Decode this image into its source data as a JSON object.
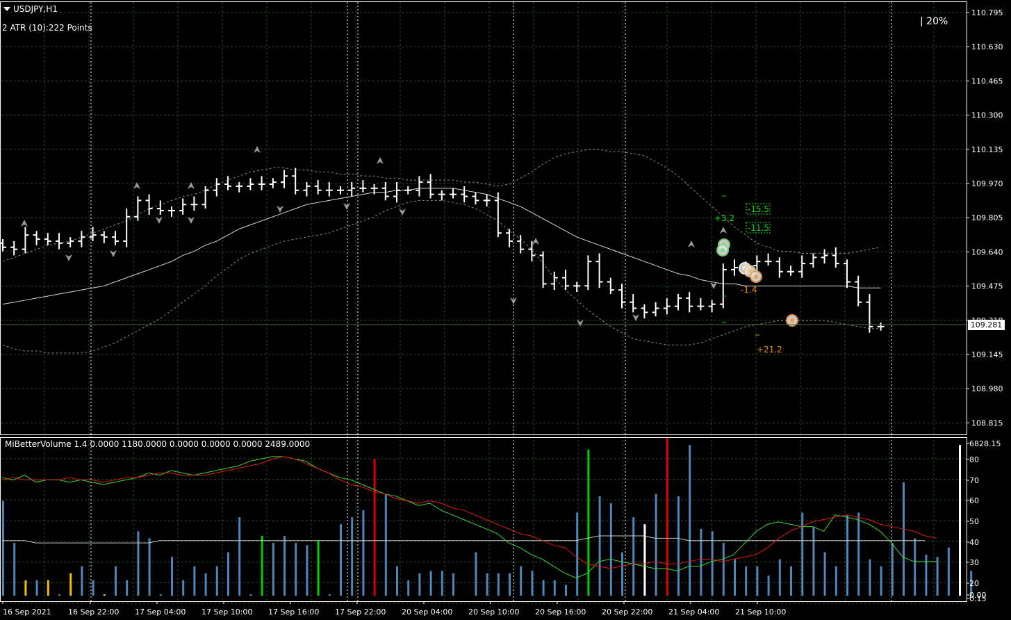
{
  "header": {
    "symbol_timeframe": "USDJPY,H1",
    "atr_text": "2 ATR (10):222 Points",
    "percent_text": "| 20%"
  },
  "price_axis": {
    "ticks": [
      "110.795",
      "110.630",
      "110.465",
      "110.300",
      "110.135",
      "109.970",
      "109.805",
      "109.640",
      "109.475",
      "109.310",
      "109.145",
      "108.980",
      "108.815"
    ],
    "current_price": "109.281"
  },
  "indicator": {
    "label": "MiBetterVolume 1.4 0.0000 1180.0000 0.0000 0.0000 0.0000 2489.0000",
    "axis_ticks": [
      "6828.15",
      "80",
      "70",
      "60",
      "50",
      "40",
      "30",
      "20",
      "0.00",
      "0.15"
    ]
  },
  "time_axis": {
    "labels": [
      "16 Sep 2021",
      "16 Sep 22:00",
      "17 Sep 04:00",
      "17 Sep 10:00",
      "17 Sep 16:00",
      "17 Sep 22:00",
      "20 Sep 04:00",
      "20 Sep 10:00",
      "20 Sep 16:00",
      "20 Sep 22:00",
      "21 Sep 04:00",
      "21 Sep 10:00"
    ]
  },
  "trade_annotations": {
    "green": [
      "+3.2",
      "-15.5",
      "-11.5"
    ],
    "orange": [
      "-1.4",
      "+21.2"
    ]
  },
  "colors": {
    "background": "#000000",
    "grid": "#2e4a2e",
    "bar": "#ffffff",
    "ma_line": "#d8d8d8",
    "envelope": "#8a8a8a",
    "vol_blue": "#4f86b8",
    "vol_green": "#00d000",
    "vol_red": "#e00000",
    "vol_white": "#ffffff",
    "vol_yellow": "#f0c000",
    "line_red": "#e01818",
    "line_green": "#38d838",
    "line_white": "#c8c8c8",
    "trade_green": "#00e000",
    "trade_orange": "#f08800"
  },
  "chart_data": {
    "type": "ohlc",
    "price": {
      "ylim": [
        108.75,
        110.875
      ],
      "closes": [
        109.67,
        109.66,
        109.73,
        109.71,
        109.7,
        109.69,
        109.7,
        109.72,
        109.73,
        109.72,
        109.7,
        109.82,
        109.9,
        109.86,
        109.85,
        109.85,
        109.88,
        109.88,
        109.95,
        109.98,
        109.97,
        109.97,
        109.98,
        109.98,
        109.99,
        110.02,
        109.95,
        109.97,
        109.95,
        109.95,
        109.95,
        109.96,
        109.96,
        109.96,
        109.92,
        109.95,
        109.95,
        109.99,
        109.93,
        109.93,
        109.93,
        109.92,
        109.9,
        109.9,
        109.74,
        109.7,
        109.66,
        109.63,
        109.49,
        109.52,
        109.48,
        109.48,
        109.6,
        109.5,
        109.46,
        109.4,
        109.37,
        109.35,
        109.37,
        109.38,
        109.42,
        109.38,
        109.38,
        109.39,
        109.56,
        109.57,
        109.58,
        109.6,
        109.6,
        109.55,
        109.55,
        109.59,
        109.62,
        109.63,
        109.59,
        109.5,
        109.4,
        109.28,
        109.28
      ],
      "ma": [
        109.39,
        109.4,
        109.41,
        109.42,
        109.43,
        109.44,
        109.45,
        109.46,
        109.47,
        109.48,
        109.5,
        109.52,
        109.54,
        109.56,
        109.58,
        109.6,
        109.63,
        109.65,
        109.68,
        109.7,
        109.73,
        109.76,
        109.78,
        109.8,
        109.82,
        109.84,
        109.86,
        109.88,
        109.89,
        109.9,
        109.91,
        109.92,
        109.93,
        109.94,
        109.94,
        109.95,
        109.95,
        109.96,
        109.96,
        109.96,
        109.96,
        109.95,
        109.94,
        109.93,
        109.91,
        109.89,
        109.87,
        109.84,
        109.81,
        109.78,
        109.75,
        109.72,
        109.7,
        109.68,
        109.66,
        109.64,
        109.62,
        109.6,
        109.58,
        109.56,
        109.54,
        109.53,
        109.51,
        109.5,
        109.49,
        109.49,
        109.48,
        109.48,
        109.48,
        109.48,
        109.48,
        109.48,
        109.48,
        109.48,
        109.48,
        109.48,
        109.47,
        109.47,
        109.47
      ],
      "upper": [
        109.6,
        109.62,
        109.64,
        109.66,
        109.68,
        109.69,
        109.7,
        109.72,
        109.74,
        109.76,
        109.78,
        109.8,
        109.83,
        109.86,
        109.88,
        109.9,
        109.92,
        109.93,
        109.95,
        109.98,
        110.0,
        110.02,
        110.04,
        110.05,
        110.06,
        110.06,
        110.05,
        110.05,
        110.04,
        110.04,
        110.03,
        110.03,
        110.02,
        110.02,
        110.01,
        110.01,
        110.0,
        110.0,
        110.0,
        110.0,
        110.0,
        109.99,
        109.99,
        109.98,
        109.97,
        109.98,
        110.01,
        110.04,
        110.08,
        110.11,
        110.13,
        110.14,
        110.15,
        110.15,
        110.14,
        110.14,
        110.13,
        110.12,
        110.09,
        110.06,
        110.02,
        109.97,
        109.92,
        109.87,
        109.82,
        109.77,
        109.73,
        109.69,
        109.67,
        109.65,
        109.65,
        109.64,
        109.64,
        109.64,
        109.64,
        109.64,
        109.65,
        109.66,
        109.67
      ],
      "lower": [
        109.19,
        109.17,
        109.16,
        109.16,
        109.15,
        109.15,
        109.15,
        109.15,
        109.16,
        109.18,
        109.2,
        109.23,
        109.26,
        109.29,
        109.32,
        109.36,
        109.4,
        109.44,
        109.48,
        109.53,
        109.57,
        109.61,
        109.64,
        109.66,
        109.68,
        109.7,
        109.71,
        109.72,
        109.73,
        109.74,
        109.76,
        109.78,
        109.8,
        109.82,
        109.85,
        109.87,
        109.89,
        109.9,
        109.9,
        109.9,
        109.89,
        109.88,
        109.86,
        109.83,
        109.8,
        109.75,
        109.71,
        109.66,
        109.59,
        109.52,
        109.46,
        109.41,
        109.36,
        109.32,
        109.28,
        109.25,
        109.22,
        109.21,
        109.2,
        109.19,
        109.19,
        109.19,
        109.2,
        109.22,
        109.24,
        109.26,
        109.28,
        109.29,
        109.3,
        109.31,
        109.31,
        109.31,
        109.31,
        109.31,
        109.3,
        109.29,
        109.28,
        109.27,
        109.27
      ]
    },
    "volume": {
      "ylim": [
        15,
        85
      ],
      "values": [
        58,
        40,
        24,
        24,
        24,
        18,
        27,
        30,
        24,
        18,
        30,
        24,
        45,
        42,
        18,
        34,
        24,
        30,
        27,
        30,
        36,
        51,
        18,
        43,
        40,
        43,
        40,
        39,
        41,
        18,
        48,
        51,
        54,
        76,
        61,
        30,
        24,
        27,
        28,
        28,
        27,
        16,
        36,
        27,
        27,
        27,
        30,
        28,
        24,
        24,
        22,
        53,
        80,
        60,
        57,
        36,
        51,
        48,
        61,
        85,
        60,
        82,
        46,
        45,
        40,
        33,
        30,
        30,
        26,
        33,
        30,
        53,
        47,
        36,
        30,
        52,
        53,
        33,
        30,
        40,
        66,
        42,
        35,
        34,
        38,
        82,
        28
      ],
      "colors": [
        "b",
        "b",
        "y",
        "b",
        "y",
        "b",
        "y",
        "b",
        "b",
        "y",
        "b",
        "b",
        "b",
        "b",
        "b",
        "b",
        "b",
        "b",
        "b",
        "b",
        "b",
        "b",
        "b",
        "g",
        "b",
        "b",
        "b",
        "b",
        "g",
        "b",
        "b",
        "b",
        "b",
        "r",
        "b",
        "b",
        "b",
        "b",
        "b",
        "b",
        "b",
        "y",
        "b",
        "b",
        "b",
        "b",
        "b",
        "b",
        "b",
        "b",
        "b",
        "b",
        "g",
        "b",
        "b",
        "b",
        "b",
        "w",
        "b",
        "r",
        "b",
        "b",
        "b",
        "b",
        "b",
        "b",
        "b",
        "b",
        "b",
        "b",
        "b",
        "b",
        "b",
        "b",
        "b",
        "b",
        "b",
        "b",
        "b",
        "b",
        "b",
        "b",
        "b",
        "b",
        "b",
        "w",
        "b"
      ],
      "red_line": [
        67,
        68,
        67,
        67,
        67,
        67,
        68,
        67,
        67,
        66,
        67,
        68,
        68,
        69,
        70,
        70,
        69,
        69,
        69,
        70,
        71,
        72,
        73,
        74,
        76,
        77,
        76,
        74,
        72,
        70,
        67,
        65,
        64,
        62,
        61,
        59,
        58,
        57,
        58,
        57,
        55,
        54,
        52,
        50,
        48,
        46,
        44,
        43,
        41,
        39,
        38,
        34,
        31,
        30,
        29,
        30,
        31,
        31,
        32,
        31,
        31,
        32,
        33,
        33,
        32,
        33,
        34,
        35,
        38,
        42,
        45,
        47,
        49,
        50,
        51,
        52,
        51,
        50,
        48,
        47,
        46,
        45,
        43,
        42
      ],
      "green_line": [
        68,
        67,
        69,
        66,
        67,
        67,
        66,
        67,
        66,
        65,
        66,
        67,
        68,
        70,
        69,
        71,
        70,
        69,
        70,
        71,
        72,
        73,
        75,
        76,
        77,
        77,
        76,
        75,
        72,
        70,
        68,
        67,
        65,
        63,
        61,
        60,
        58,
        56,
        57,
        54,
        52,
        50,
        48,
        46,
        44,
        40,
        38,
        35,
        33,
        30,
        27,
        25,
        27,
        32,
        33,
        32,
        31,
        30,
        29,
        29,
        28,
        30,
        30,
        32,
        33,
        35,
        40,
        45,
        48,
        49,
        48,
        47,
        47,
        45,
        52,
        51,
        50,
        48,
        45,
        40,
        34,
        32,
        32,
        32
      ],
      "white_line": [
        41,
        41,
        41,
        40,
        40,
        40,
        40,
        40,
        40,
        40,
        40,
        40,
        40,
        40,
        41,
        41,
        41,
        41,
        41,
        41,
        41,
        41,
        41,
        41,
        41,
        41,
        41,
        41,
        41,
        41,
        41,
        41,
        41,
        41,
        41,
        41,
        41,
        41,
        41,
        41,
        41,
        41,
        41,
        41,
        41,
        41,
        41,
        41,
        41,
        41,
        41,
        41,
        42,
        43,
        43,
        43,
        43,
        43,
        42,
        42,
        42,
        41,
        41,
        41,
        41,
        41,
        41,
        41,
        41,
        41,
        41,
        41,
        41,
        41,
        41,
        41,
        41,
        41,
        41,
        41,
        41,
        41,
        41
      ]
    }
  }
}
